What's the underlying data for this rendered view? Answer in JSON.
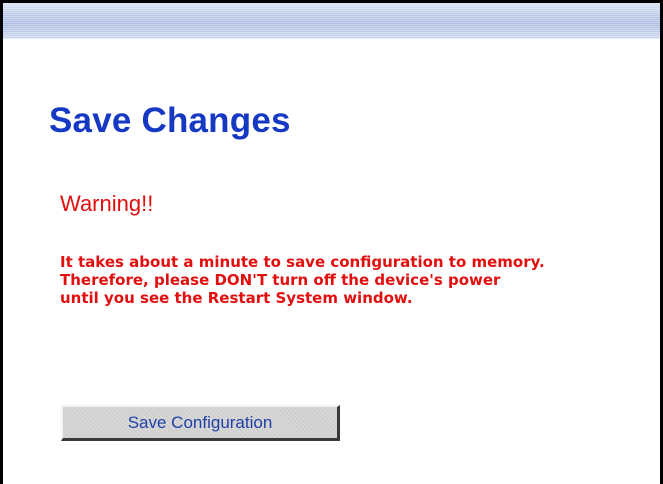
{
  "page": {
    "title": "Save Changes"
  },
  "warning": {
    "heading": "Warning!!",
    "lines": [
      "It takes about a minute to save configuration to memory.",
      "Therefore, please DON'T turn off the device's power",
      "until you see the Restart System window."
    ]
  },
  "actions": {
    "save_label": "Save Configuration"
  },
  "colors": {
    "title": "#1639c4",
    "warning": "#e20f0f",
    "button_face": "#cfcfcf",
    "button_text": "#1f3fa8"
  }
}
